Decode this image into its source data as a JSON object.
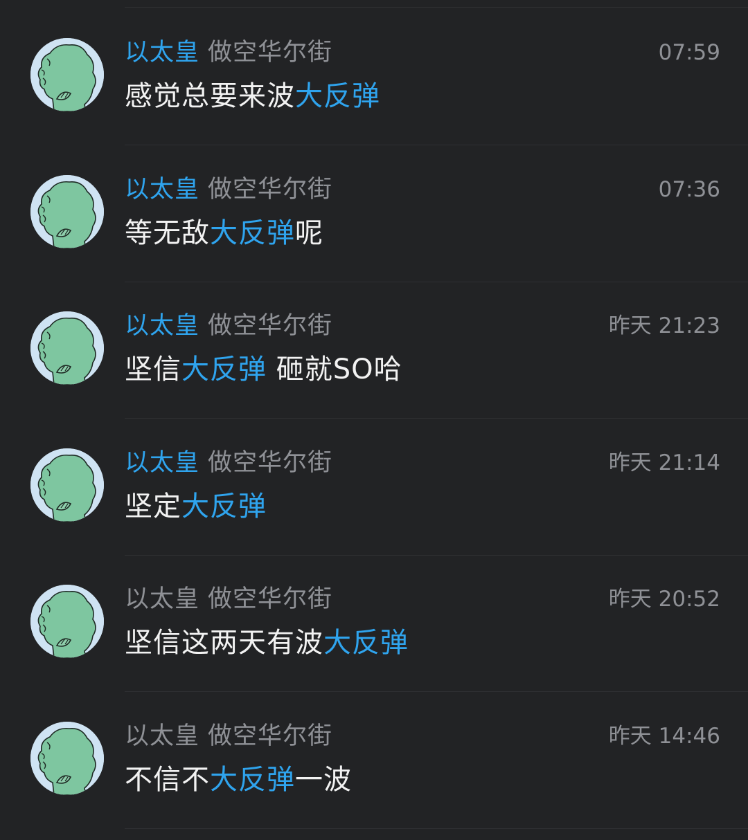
{
  "colors": {
    "background": "#222325",
    "highlight": "#2fa4ee",
    "muted": "#8f9196",
    "text": "#f2f2f2",
    "avatar_fill": "#7ec6a0",
    "avatar_bg": "#cfe3f3"
  },
  "messages": [
    {
      "user": "以太皇",
      "user_highlighted": true,
      "group": "做空华尔街",
      "time": "07:59",
      "segments": [
        {
          "text": "感觉总要来波",
          "hl": false
        },
        {
          "text": "大反弹",
          "hl": true
        }
      ]
    },
    {
      "user": "以太皇",
      "user_highlighted": true,
      "group": "做空华尔街",
      "time": "07:36",
      "segments": [
        {
          "text": "等无敌",
          "hl": false
        },
        {
          "text": "大反弹",
          "hl": true
        },
        {
          "text": "呢",
          "hl": false
        }
      ]
    },
    {
      "user": "以太皇",
      "user_highlighted": true,
      "group": "做空华尔街",
      "time": "昨天 21:23",
      "segments": [
        {
          "text": "坚信",
          "hl": false
        },
        {
          "text": "大反弹",
          "hl": true
        },
        {
          "text": " 砸就SO哈",
          "hl": false
        }
      ]
    },
    {
      "user": "以太皇",
      "user_highlighted": true,
      "group": "做空华尔街",
      "time": "昨天 21:14",
      "segments": [
        {
          "text": "坚定",
          "hl": false
        },
        {
          "text": "大反弹",
          "hl": true
        }
      ]
    },
    {
      "user": "以太皇",
      "user_highlighted": false,
      "group": "做空华尔街",
      "time": "昨天 20:52",
      "segments": [
        {
          "text": "坚信这两天有波",
          "hl": false
        },
        {
          "text": "大反弹",
          "hl": true
        }
      ]
    },
    {
      "user": "以太皇",
      "user_highlighted": false,
      "group": "做空华尔街",
      "time": "昨天 14:46",
      "segments": [
        {
          "text": "不信不",
          "hl": false
        },
        {
          "text": "大反弹",
          "hl": true
        },
        {
          "text": "一波",
          "hl": false
        }
      ]
    }
  ]
}
